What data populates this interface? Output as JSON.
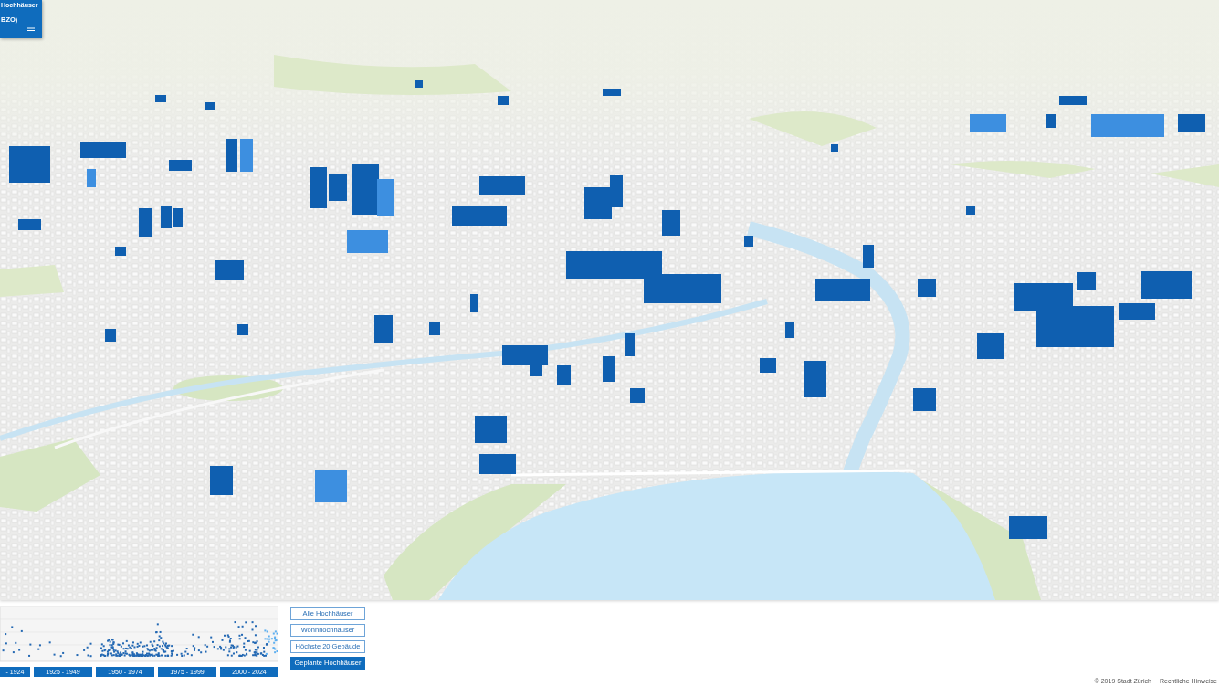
{
  "panel": {
    "title": "Hochhäuser",
    "subtitle": "BZO)"
  },
  "timeline": {
    "periods": [
      {
        "label": "- 1924"
      },
      {
        "label": "1925 - 1949"
      },
      {
        "label": "1950 - 1974"
      },
      {
        "label": "1975 - 1999"
      },
      {
        "label": "2000 - 2024"
      }
    ]
  },
  "filters": [
    {
      "label": "Alle Hochhäuser",
      "selected": false
    },
    {
      "label": "Wohnhochhäuser",
      "selected": false
    },
    {
      "label": "Höchste 20 Gebäude",
      "selected": false
    },
    {
      "label": "Geplante Hochhäuser",
      "selected": true
    }
  ],
  "footer": {
    "copyright": "© 2019 Stadt Zürich",
    "legal_link": "Rechtliche Hinweise"
  }
}
